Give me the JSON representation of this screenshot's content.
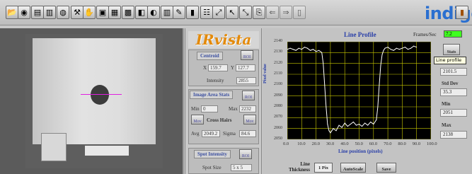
{
  "toolbar": {
    "buttons": [
      {
        "icon": "open-folder-icon",
        "glyph": "📂"
      },
      {
        "icon": "camera-icon",
        "glyph": "◉"
      },
      {
        "icon": "save-icon",
        "glyph": "▤"
      },
      {
        "icon": "save-as-icon",
        "glyph": "▥"
      },
      {
        "icon": "disk-icon",
        "glyph": "◍"
      },
      {
        "icon": "tools-icon",
        "glyph": "⚒"
      },
      {
        "icon": "grab-icon",
        "glyph": "✋"
      },
      {
        "icon": "frame-icon",
        "glyph": "▣"
      },
      {
        "icon": "image-icon",
        "glyph": "▦"
      },
      {
        "icon": "grid-icon",
        "glyph": "▩"
      },
      {
        "icon": "overlay-icon",
        "glyph": "◧"
      },
      {
        "icon": "palette-icon",
        "glyph": "◐"
      },
      {
        "icon": "histogram-icon",
        "glyph": "▥"
      },
      {
        "icon": "bucket-icon",
        "glyph": "✎"
      },
      {
        "icon": "bars-icon",
        "glyph": "▮"
      },
      {
        "icon": "channels-icon",
        "glyph": "☷"
      },
      {
        "icon": "zoom-icon",
        "glyph": "⤢"
      },
      {
        "icon": "cursor-icon",
        "glyph": "↖"
      },
      {
        "icon": "pan-icon",
        "glyph": "⤡"
      },
      {
        "icon": "export-icon",
        "glyph": "⎘"
      },
      {
        "icon": "arrow-left-icon",
        "glyph": "⇐"
      },
      {
        "icon": "arrow-right-icon",
        "glyph": "⇒"
      },
      {
        "icon": "document-icon",
        "glyph": "▯"
      }
    ],
    "logo": "indigo",
    "exit_glyph": "▮"
  },
  "irvista": "IRvista",
  "centroid": {
    "title": "Centroid",
    "x_label": "X",
    "x_value": "159.7",
    "y_label": "Y",
    "y_value": "127.7",
    "intensity_label": "Intensity",
    "intensity_value": "2855"
  },
  "image_area_stats": {
    "title": "Image Area Stats",
    "min_label": "Min",
    "min_value": "0",
    "max_label": "Max",
    "max_value": "2232",
    "cross_hairs_label": "Cross Hairs",
    "avg_label": "Avg",
    "avg_value": "2049.2",
    "sigma_label": "Sigma",
    "sigma_value": "84.6"
  },
  "spot_intensity": {
    "title": "Spot Intensity",
    "spot_size_label": "Spot Size",
    "spot_size_value": "5 x 5"
  },
  "roi_label": "ROI",
  "mov_label": "Mov",
  "show_label": "Show",
  "line_profile": {
    "title": "Line Profile",
    "frames_label": "Frames/Sec",
    "frames_value": "7.2",
    "stats_button": "Stats",
    "tooltip": "Line profile",
    "stats": [
      {
        "label": "",
        "value": "2101.5"
      },
      {
        "label": "Std Dev",
        "value": "35.3"
      },
      {
        "label": "Min",
        "value": "2051"
      },
      {
        "label": "Max",
        "value": "2138"
      }
    ],
    "line_thickness_label_1": "Line",
    "line_thickness_label_2": "Thickness",
    "line_thickness_value": "1 Pix",
    "autoscale_button": "AutoScale",
    "save_button": "Save"
  },
  "chart_data": {
    "type": "line",
    "title": "Line Profile",
    "xlabel": "Line position (pixels)",
    "ylabel": "Pixel value",
    "xlim": [
      0,
      100
    ],
    "ylim": [
      2050,
      2140
    ],
    "x_ticks": [
      "0.0",
      "10.0",
      "20.0",
      "30.0",
      "40.0",
      "50.0",
      "60.0",
      "70.0",
      "80.0",
      "90.0",
      "100.0"
    ],
    "y_ticks": [
      "2140",
      "2130",
      "2120",
      "2110",
      "2100",
      "2090",
      "2080",
      "2070",
      "2060",
      "2050"
    ],
    "grid": true,
    "series": [
      {
        "color": "#ffffff",
        "x": [
          0,
          2,
          4,
          6,
          8,
          10,
          12,
          14,
          16,
          18,
          20,
          22,
          24,
          25,
          26,
          27,
          28,
          29,
          30,
          32,
          34,
          36,
          38,
          40,
          42,
          44,
          46,
          48,
          50,
          52,
          54,
          56,
          58,
          60,
          62,
          63,
          64,
          65,
          66,
          67,
          68,
          70,
          72,
          74,
          76,
          78,
          80,
          82,
          84,
          86,
          88,
          90
        ],
        "y": [
          2133,
          2134,
          2133,
          2132,
          2134,
          2133,
          2135,
          2134,
          2132,
          2133,
          2131,
          2132,
          2130,
          2120,
          2100,
          2080,
          2064,
          2058,
          2056,
          2060,
          2058,
          2063,
          2061,
          2065,
          2062,
          2064,
          2066,
          2063,
          2064,
          2062,
          2065,
          2063,
          2066,
          2064,
          2068,
          2080,
          2100,
          2118,
          2128,
          2132,
          2134,
          2135,
          2133,
          2132,
          2134,
          2133,
          2134,
          2135,
          2133,
          2134,
          2136,
          2135
        ]
      }
    ]
  }
}
